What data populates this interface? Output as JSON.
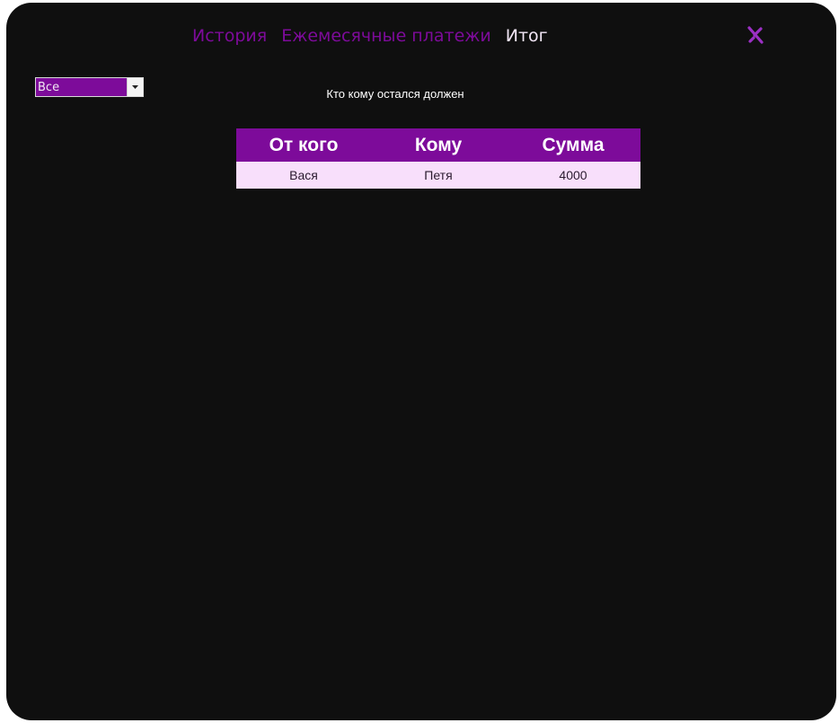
{
  "tabs": [
    {
      "label": "История",
      "active": false
    },
    {
      "label": "Ежемесячные платежи",
      "active": false
    },
    {
      "label": "Итог",
      "active": true
    }
  ],
  "close_icon": "close-icon",
  "filter": {
    "selected": "Все"
  },
  "caption": "Кто кому остался должен",
  "table": {
    "headers": [
      "От кого",
      "Кому",
      "Сумма"
    ],
    "rows": [
      [
        "Вася",
        "Петя",
        "4000"
      ]
    ]
  },
  "colors": {
    "background": "#0f0f0f",
    "accent": "#7d0b9a",
    "row_background": "#f8dffb",
    "active_tab": "#f2e6f6"
  }
}
